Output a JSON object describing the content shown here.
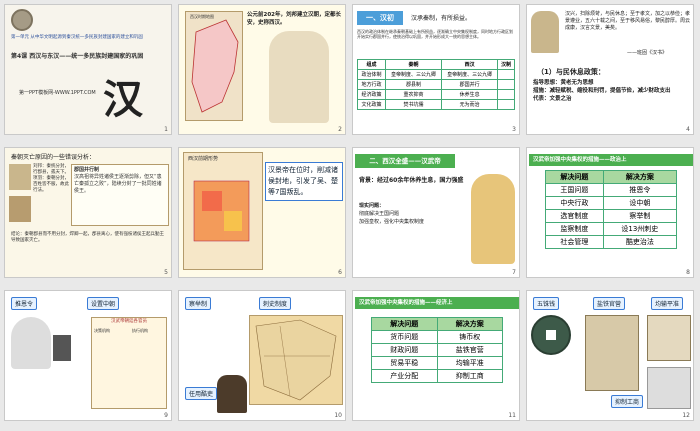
{
  "slides": [
    {
      "number": "1",
      "header_text": "第一单元 从中华文明起源到秦汉统一多民族封建国家的建立和巩固",
      "chapter_title": "第4课 西汉与东汉——统一多民族封建国家的巩固",
      "big_char": "汉",
      "footer": "第一PPT模板网-WWW.1PPT.COM"
    },
    {
      "number": "2",
      "caption": "公元前202年，刘邦建立汉朝，定都长安，史称西汉。",
      "map_title": "西汉时期地图"
    },
    {
      "number": "3",
      "section": "一、汉初",
      "subtitle": "汉承秦制，有所损益。",
      "desc": "西汉的政治体制在继承秦朝基础上有所损益，逐渐确立中央集权制度，同时地方行政区划开始实行郡国并行，使统治得以巩固，并开始形成大一统的思想主体。",
      "table_headers": [
        "组成",
        "秦朝",
        "西汉",
        "汉制"
      ],
      "table_rows": [
        [
          "政治体制",
          "皇帝制度、三公九卿",
          "皇帝制度、三公九卿",
          ""
        ],
        [
          "地方行政",
          "郡县制",
          "郡国并行",
          ""
        ],
        [
          "经济政策",
          "重农抑商",
          "休养生息",
          ""
        ],
        [
          "文化政策",
          "焚书坑儒",
          "无为而治",
          ""
        ]
      ]
    },
    {
      "number": "4",
      "quote": "汉兴，扫除烦苛，与民休息；至于孝文，加之以恭俭；孝景遵业，五六十载之间，至于移风易俗，黎民醇厚。周云成康，汉言文景，美矣。",
      "quote_source": "——班固《汉书》",
      "policy_title": "（1）与民休息政策：",
      "policy_lines": [
        "指导思想：黄老无为思想",
        "措施：减轻赋税、缩役和刑罚，提倡节俭，减少财政支出",
        "代表：文景之治"
      ]
    },
    {
      "number": "5",
      "title": "秦朝灭亡原因的一些错误分析：",
      "lines": [
        "刘邦：秦统分封，行郡县，孤天下。",
        "项羽：秦朝分封，百姓皆不服，故此行法。",
        "郡国并行制"
      ],
      "highlight": "汉高祖将异姓诸侯王逐渐剪除，但又“患亡秦孤立之败”，陆续分封了一批同姓诸侯王。",
      "bottom": "结论：秦朝郡县而不用分封，焊卿一起，郡县离心，使有强枝诸侯王起兵勤王导致国家灭亡。"
    },
    {
      "number": "6",
      "map_title": "西汉前期形势",
      "text": "汉景帝在位时，削减诸侯封地，引发了吴、楚等7国叛乱。"
    },
    {
      "number": "7",
      "section": "二、西汉全盛——汉武帝",
      "background": "背景：经过60余年休养生息，国力强盛",
      "task_title": "现实问题：",
      "task_lines": [
        "彻底解决王国问题",
        "加强皇权，强化中央集权制度"
      ]
    },
    {
      "number": "8",
      "title": "汉武帝加强中央集权的措施——政治上",
      "headers": [
        "解决问题",
        "解决方案"
      ],
      "rows": [
        [
          "王国问题",
          "推恩令"
        ],
        [
          "中央行政",
          "设中朝"
        ],
        [
          "选官制度",
          "察举制"
        ],
        [
          "监察制度",
          "设13州刺史"
        ],
        [
          "社会管理",
          "酷吏治法"
        ]
      ]
    },
    {
      "number": "9",
      "btn1": "推恩令",
      "btn2": "设置中朝",
      "chart_title": "汉武帝朝廷各官员",
      "col1": "决策机构",
      "col2": "执行机构"
    },
    {
      "number": "10",
      "btn1": "察举制",
      "btn2": "刺史制度",
      "btn3": "任用酷吏"
    },
    {
      "number": "11",
      "title": "汉武帝加强中央集权的措施——经济上",
      "headers": [
        "解决问题",
        "解决方案"
      ],
      "rows": [
        [
          "货币问题",
          "铸币权"
        ],
        [
          "财政问题",
          "盐铁官营"
        ],
        [
          "贸易平稳",
          "均输平准"
        ],
        [
          "产业分配",
          "抑制工商"
        ]
      ]
    },
    {
      "number": "12",
      "btn1": "五铢钱",
      "btn2": "盐铁官营",
      "btn3": "均输平准",
      "btn4": "抑制工商"
    }
  ]
}
